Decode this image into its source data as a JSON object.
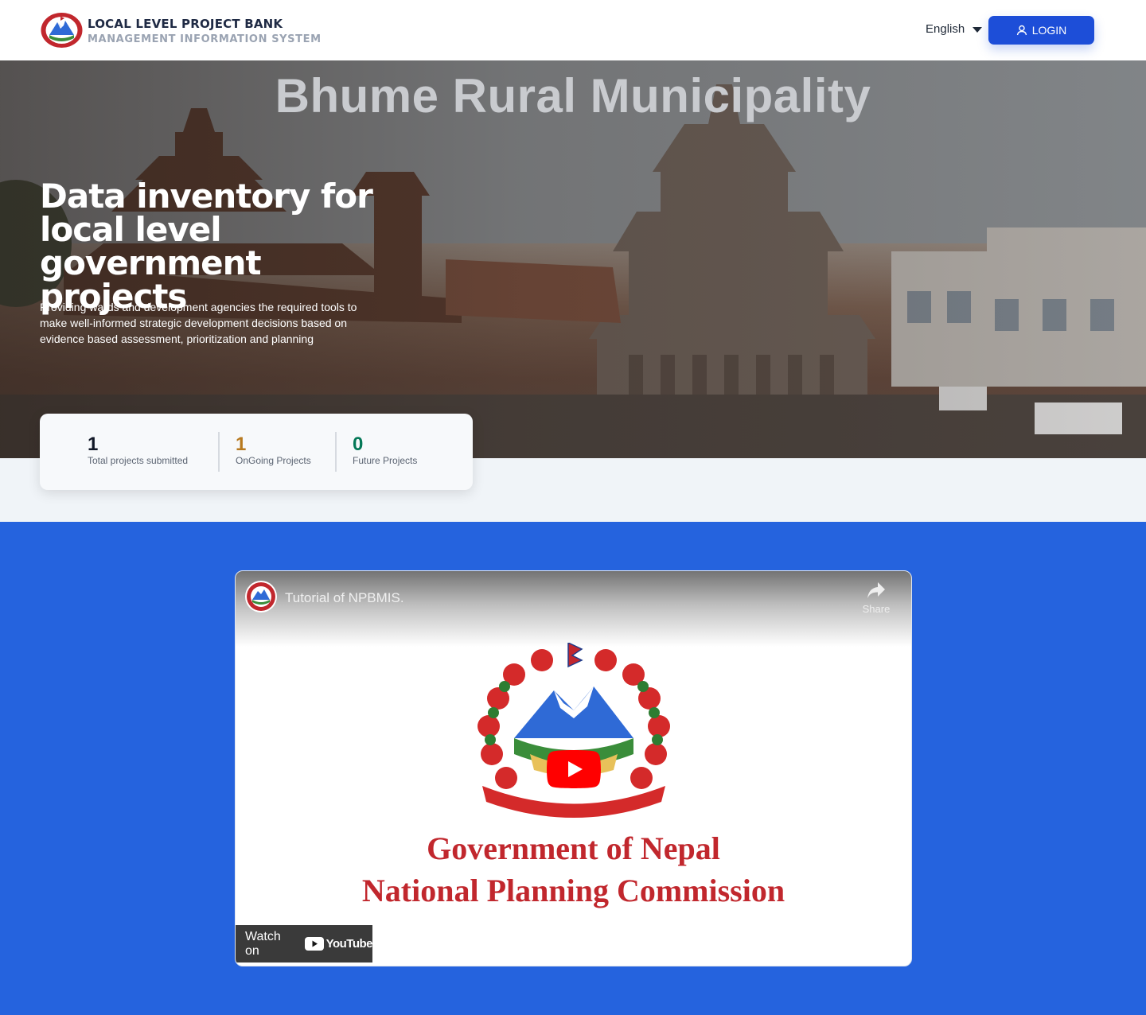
{
  "header": {
    "brand_title": "LOCAL LEVEL PROJECT BANK",
    "brand_subtitle": "MANAGEMENT INFORMATION SYSTEM",
    "language": "English",
    "login_label": "LOGIN"
  },
  "hero": {
    "municipality": "Bhume Rural Municipality",
    "title": "Data inventory for local level government projects",
    "description": "Providing wards and development agencies the required tools to make well-informed strategic development decisions based on evidence based assessment, prioritization and planning"
  },
  "stats": [
    {
      "value": "1",
      "label": "Total projects submitted",
      "color": "#111827"
    },
    {
      "value": "1",
      "label": "OnGoing Projects",
      "color": "#b7791f"
    },
    {
      "value": "0",
      "label": "Future Projects",
      "color": "#047857"
    }
  ],
  "video": {
    "title": "Tutorial of NPBMIS.",
    "share_label": "Share",
    "line1": "Government of Nepal",
    "line2": "National Planning Commission",
    "watch_on": "Watch on",
    "youtube_label": "YouTube"
  },
  "colors": {
    "primary": "#1d4ed8",
    "section_blue": "#2563de",
    "nepal_red": "#c1272d"
  }
}
